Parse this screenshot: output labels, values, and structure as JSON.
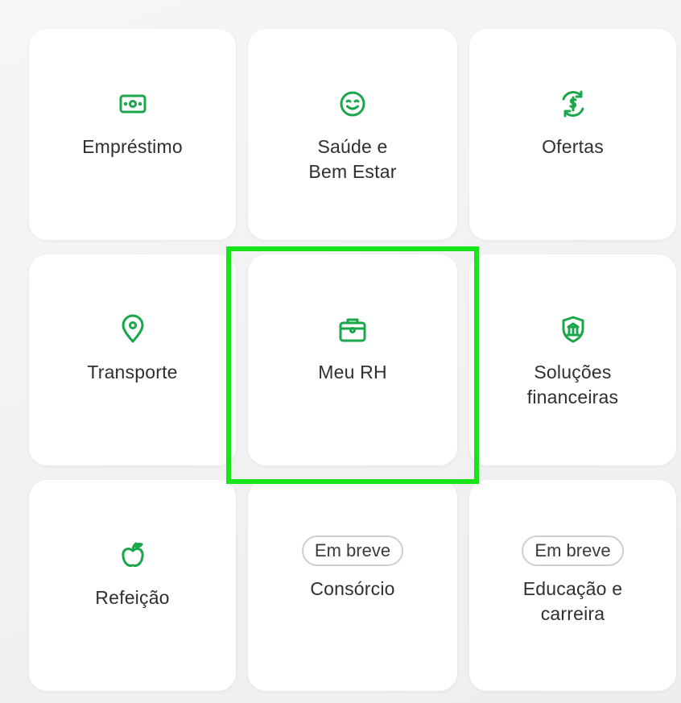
{
  "accent_color": "#1aa64a",
  "highlight_color": "#19e419",
  "cards": [
    {
      "icon": "money-bill-icon",
      "label_lines": [
        "Empréstimo"
      ]
    },
    {
      "icon": "smiley-face-icon",
      "label_lines": [
        "Saúde e",
        "Bem Estar"
      ]
    },
    {
      "icon": "dollar-cycle-icon",
      "label_lines": [
        "Ofertas"
      ]
    },
    {
      "icon": "location-pin-icon",
      "label_lines": [
        "Transporte"
      ]
    },
    {
      "icon": "briefcase-icon",
      "label_lines": [
        "Meu RH"
      ]
    },
    {
      "icon": "bank-shield-icon",
      "label_lines": [
        "Soluções",
        "financeiras"
      ]
    },
    {
      "icon": "apple-icon",
      "label_lines": [
        "Refeição"
      ]
    },
    {
      "badge": "Em breve",
      "label_lines": [
        "Consórcio"
      ]
    },
    {
      "badge": "Em breve",
      "label_lines": [
        "Educação e",
        "carreira"
      ]
    }
  ]
}
